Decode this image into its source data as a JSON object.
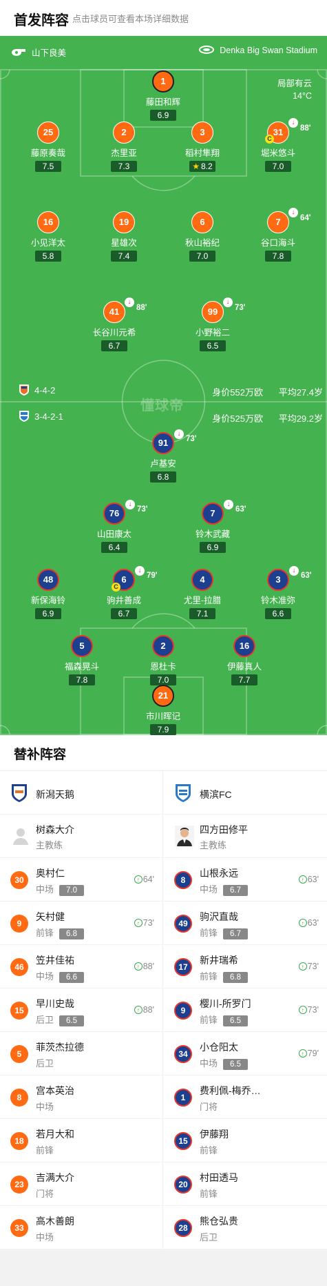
{
  "header": {
    "title": "首发阵容",
    "subtitle": "点击球员可查看本场详细数据"
  },
  "match": {
    "referee": "山下良美",
    "stadium": "Denka Big Swan Stadium",
    "weather": "局部有云",
    "temperature": "14°C",
    "watermark": "懂球帝"
  },
  "home_team": {
    "formation": "4-4-2",
    "value": "身价552万欧",
    "avg_age": "平均27.4岁"
  },
  "away_team": {
    "formation": "3-4-2-1",
    "value": "身价525万欧",
    "avg_age": "平均29.2岁"
  },
  "home_players": [
    {
      "num": "1",
      "name": "藤田和辉",
      "rating": "6.9",
      "gk": true
    },
    {
      "num": "25",
      "name": "藤原奏哉",
      "rating": "7.5"
    },
    {
      "num": "2",
      "name": "杰里亚",
      "rating": "7.3"
    },
    {
      "num": "3",
      "name": "稻村隼翔",
      "rating": "8.2",
      "star": true
    },
    {
      "num": "31",
      "name": "堀米悠斗",
      "rating": "7.0",
      "sub": "88'",
      "captain": true
    },
    {
      "num": "16",
      "name": "小见洋太",
      "rating": "5.8"
    },
    {
      "num": "19",
      "name": "星雄次",
      "rating": "7.4"
    },
    {
      "num": "6",
      "name": "秋山裕纪",
      "rating": "7.0"
    },
    {
      "num": "7",
      "name": "谷口海斗",
      "rating": "7.8",
      "sub": "64'"
    },
    {
      "num": "41",
      "name": "长谷川元希",
      "rating": "6.7",
      "sub": "88'"
    },
    {
      "num": "99",
      "name": "小野裕二",
      "rating": "6.5",
      "sub": "73'"
    }
  ],
  "away_players": [
    {
      "num": "91",
      "name": "卢基安",
      "rating": "6.8",
      "sub": "73'"
    },
    {
      "num": "76",
      "name": "山田康太",
      "rating": "6.4",
      "sub": "73'"
    },
    {
      "num": "7",
      "name": "铃木武藏",
      "rating": "6.9",
      "sub": "63'"
    },
    {
      "num": "48",
      "name": "新保海铃",
      "rating": "6.9"
    },
    {
      "num": "6",
      "name": "驹井善成",
      "rating": "6.7",
      "sub": "79'",
      "captain": true
    },
    {
      "num": "4",
      "name": "尤里-拉腊",
      "rating": "7.1"
    },
    {
      "num": "3",
      "name": "铃木准弥",
      "rating": "6.6",
      "sub": "63'"
    },
    {
      "num": "5",
      "name": "福森晃斗",
      "rating": "7.8"
    },
    {
      "num": "2",
      "name": "恩杜卡",
      "rating": "7.0"
    },
    {
      "num": "16",
      "name": "伊藤真人",
      "rating": "7.7"
    },
    {
      "num": "21",
      "name": "市川晖记",
      "rating": "7.9",
      "gk": true
    }
  ],
  "subs": {
    "title": "替补阵容",
    "home": {
      "team": "新潟天鹅",
      "coach": "树森大介",
      "coach_role": "主教练",
      "players": [
        {
          "num": "30",
          "name": "奥村仁",
          "pos": "中场",
          "rating": "7.0",
          "in": "64'"
        },
        {
          "num": "9",
          "name": "矢村健",
          "pos": "前锋",
          "rating": "6.8",
          "in": "73'"
        },
        {
          "num": "46",
          "name": "笠井佳祐",
          "pos": "中场",
          "rating": "6.6",
          "in": "88'"
        },
        {
          "num": "15",
          "name": "早川史哉",
          "pos": "后卫",
          "rating": "6.5",
          "in": "88'"
        },
        {
          "num": "5",
          "name": "菲茨杰拉德",
          "pos": "后卫"
        },
        {
          "num": "8",
          "name": "宫本英治",
          "pos": "中场"
        },
        {
          "num": "18",
          "name": "若月大和",
          "pos": "前锋"
        },
        {
          "num": "23",
          "name": "吉满大介",
          "pos": "门将"
        },
        {
          "num": "33",
          "name": "高木善朗",
          "pos": "中场"
        }
      ]
    },
    "away": {
      "team": "横滨FC",
      "coach": "四方田修平",
      "coach_role": "主教练",
      "players": [
        {
          "num": "8",
          "name": "山根永远",
          "pos": "中场",
          "rating": "6.7",
          "in": "63'"
        },
        {
          "num": "49",
          "name": "驹沢直哉",
          "pos": "前锋",
          "rating": "6.7",
          "in": "63'"
        },
        {
          "num": "17",
          "name": "新井瑞希",
          "pos": "前锋",
          "rating": "6.8",
          "in": "73'"
        },
        {
          "num": "9",
          "name": "樱川-所罗门",
          "pos": "前锋",
          "rating": "6.5",
          "in": "73'"
        },
        {
          "num": "34",
          "name": "小仓阳太",
          "pos": "中场",
          "rating": "6.5",
          "in": "79'"
        },
        {
          "num": "1",
          "name": "费利佩-梅乔…",
          "pos": "门将"
        },
        {
          "num": "15",
          "name": "伊藤翔",
          "pos": "前锋"
        },
        {
          "num": "20",
          "name": "村田透马",
          "pos": "前锋"
        },
        {
          "num": "28",
          "name": "熊仓弘贵",
          "pos": "后卫"
        }
      ]
    }
  },
  "colors": {
    "pitch": "#44b34f",
    "home": "#ff6a13",
    "away": "#1c3f8f",
    "away_ring": "#e8362b",
    "sub_in": "#3aa84a"
  },
  "icons": {
    "referee": "whistle-icon",
    "stadium": "stadium-icon",
    "sub_out": "sub-out-icon",
    "sub_in": "sub-in-icon",
    "captain": "captain-icon",
    "star": "star-icon"
  }
}
